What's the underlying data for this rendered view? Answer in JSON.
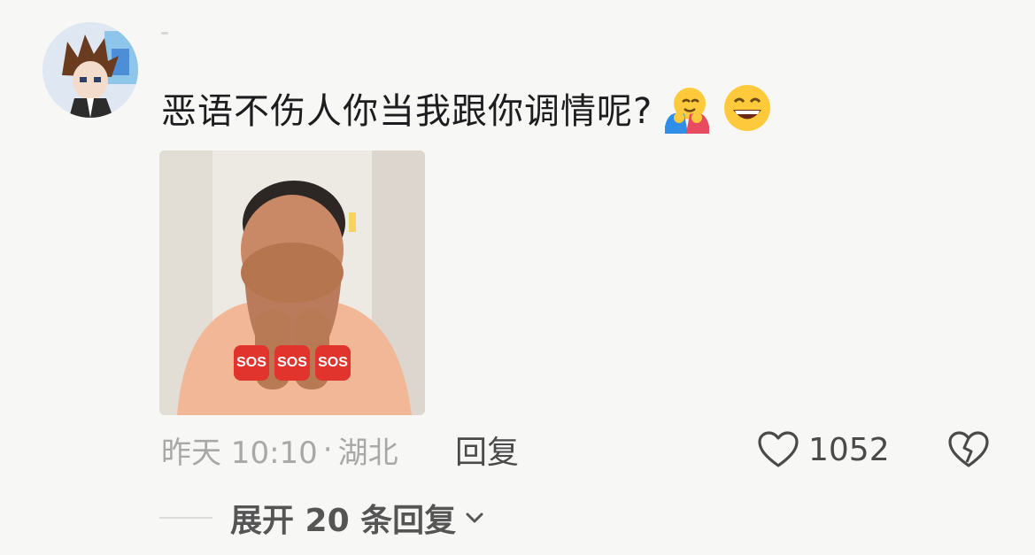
{
  "comment": {
    "text": "恶语不伤人你当我跟你调情呢?",
    "emojis": [
      "hugging-face-emoji",
      "grinning-face-emoji"
    ],
    "photo": {
      "overlay": [
        "SOS",
        "SOS",
        "SOS"
      ]
    }
  },
  "meta": {
    "time": "昨天 10:10",
    "separator": "·",
    "location": "湖北",
    "reply_label": "回复"
  },
  "actions": {
    "like_icon": "heart-outline-icon",
    "like_count": "1052",
    "dislike_icon": "broken-heart-icon"
  },
  "replies": {
    "expand_label": "展开 20 条回复",
    "expand_icon": "chevron-down-icon"
  },
  "colors": {
    "background": "#f7f7f5",
    "text_primary": "#1d1d1f",
    "text_secondary": "#a8a8a8",
    "action_text": "#4a4a4a",
    "sos_red": "#e0342c"
  }
}
